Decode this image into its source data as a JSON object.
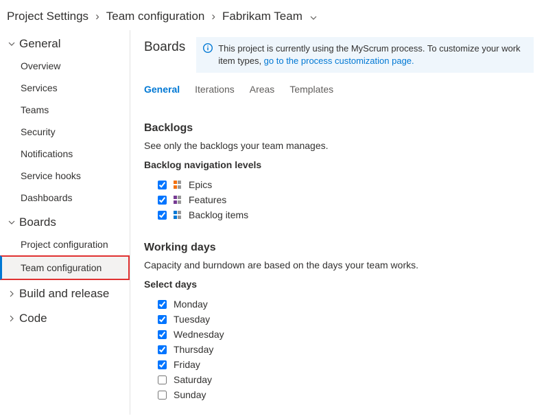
{
  "breadcrumb": {
    "root": "Project Settings",
    "mid": "Team configuration",
    "leaf": "Fabrikam Team"
  },
  "sidebar": {
    "sections": [
      {
        "title": "General",
        "expanded": true,
        "items": [
          {
            "label": "Overview"
          },
          {
            "label": "Services"
          },
          {
            "label": "Teams"
          },
          {
            "label": "Security"
          },
          {
            "label": "Notifications"
          },
          {
            "label": "Service hooks"
          },
          {
            "label": "Dashboards"
          }
        ]
      },
      {
        "title": "Boards",
        "expanded": true,
        "items": [
          {
            "label": "Project configuration"
          },
          {
            "label": "Team configuration",
            "selected": true,
            "highlight": true
          }
        ]
      },
      {
        "title": "Build and release",
        "expanded": false,
        "items": []
      },
      {
        "title": "Code",
        "expanded": false,
        "items": []
      }
    ]
  },
  "main": {
    "title": "Boards",
    "banner": {
      "text_before": "This project is currently using the MyScrum process. To customize your work item types, ",
      "link": "go to the process customization page.",
      "text_after": ""
    },
    "tabs": [
      {
        "label": "General",
        "active": true
      },
      {
        "label": "Iterations"
      },
      {
        "label": "Areas"
      },
      {
        "label": "Templates"
      }
    ],
    "backlogs": {
      "heading": "Backlogs",
      "desc": "See only the backlogs your team manages.",
      "sub": "Backlog navigation levels",
      "levels": [
        {
          "label": "Epics",
          "checked": true,
          "iconType": "epic"
        },
        {
          "label": "Features",
          "checked": true,
          "iconType": "feature"
        },
        {
          "label": "Backlog items",
          "checked": true,
          "iconType": "backlog"
        }
      ]
    },
    "working": {
      "heading": "Working days",
      "desc": "Capacity and burndown are based on the days your team works.",
      "sub": "Select days",
      "days": [
        {
          "label": "Monday",
          "checked": true
        },
        {
          "label": "Tuesday",
          "checked": true
        },
        {
          "label": "Wednesday",
          "checked": true
        },
        {
          "label": "Thursday",
          "checked": true
        },
        {
          "label": "Friday",
          "checked": true
        },
        {
          "label": "Saturday",
          "checked": false
        },
        {
          "label": "Sunday",
          "checked": false
        }
      ]
    }
  }
}
